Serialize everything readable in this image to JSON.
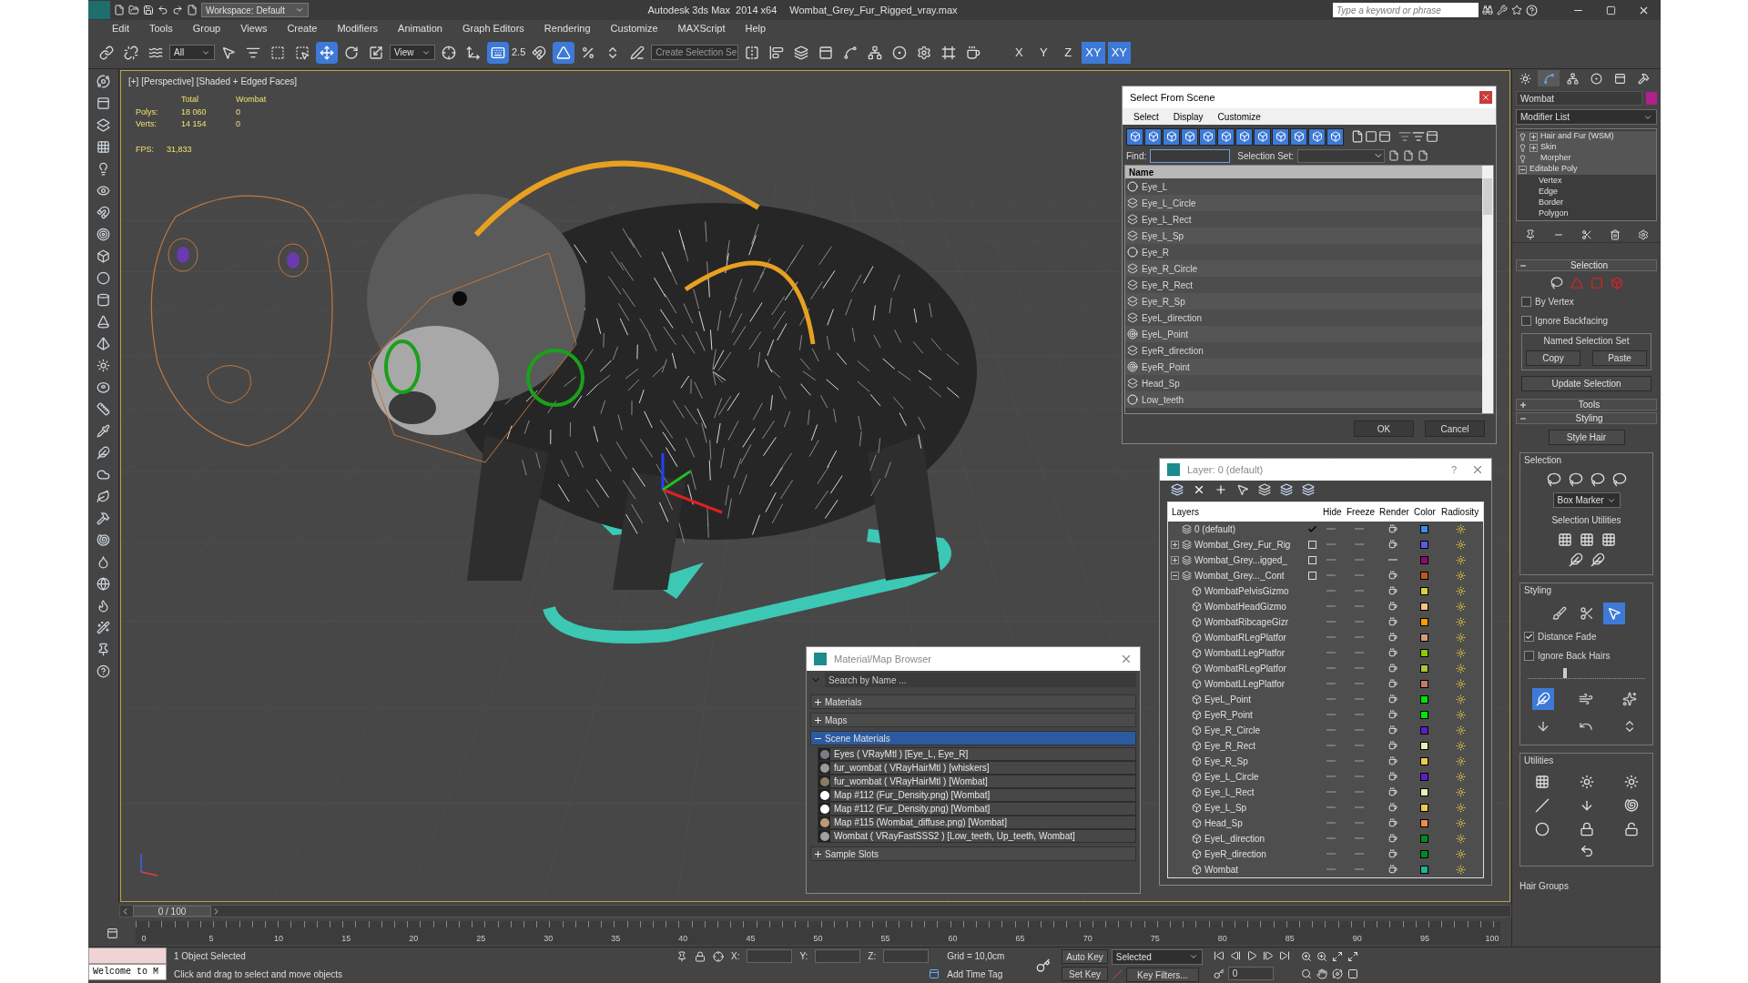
{
  "window": {
    "workspace": "Workspace: Default",
    "title": "Autodesk 3ds Max  2014 x64",
    "file": "Wombat_Grey_Fur_Rigged_vray.max",
    "search_placeholder": "Type a keyword or phrase"
  },
  "menu": [
    "Edit",
    "Tools",
    "Group",
    "Views",
    "Create",
    "Modifiers",
    "Animation",
    "Graph Editors",
    "Rendering",
    "Customize",
    "MAXScript",
    "Help"
  ],
  "toolbar": {
    "filter": "All",
    "reference": "View",
    "snap_label": "2.5",
    "selection_set_placeholder": "Create Selection Se",
    "buttons": [
      {
        "selected": false
      },
      {
        "selected": false
      },
      {
        "selected": false
      },
      {
        "selected": false
      },
      {
        "selected": false
      },
      {
        "selected": false
      },
      {
        "selected": false
      },
      {
        "selected": true
      },
      {
        "selected": false
      },
      {
        "selected": false
      },
      {
        "selected": false
      },
      {
        "selected": false
      },
      {
        "selected": true
      },
      {
        "selected": false
      },
      {
        "selected": true
      },
      {
        "selected": false
      },
      {
        "selected": false
      },
      {
        "selected": false
      },
      {
        "selected": false
      },
      {
        "selected": false
      },
      {
        "selected": false
      },
      {
        "selected": false
      },
      {
        "selected": false
      },
      {
        "selected": false
      },
      {
        "selected": false
      },
      {
        "selected": false
      },
      {
        "selected": false
      },
      {
        "selected": false
      }
    ],
    "axes": [
      {
        "label": "X",
        "selected": false
      },
      {
        "label": "Y",
        "selected": false
      },
      {
        "label": "Z",
        "selected": false
      },
      {
        "label": "XY",
        "selected": true
      },
      {
        "label": "XY",
        "selected": true
      }
    ]
  },
  "viewport": {
    "label": "[+] [Perspective] [Shaded + Edged Faces]",
    "stats_headers": [
      "Total",
      "Wombat"
    ],
    "stats": [
      {
        "label": "Polys:",
        "values": [
          "18 060",
          "0"
        ]
      },
      {
        "label": "Verts:",
        "values": [
          "14 154",
          "0"
        ]
      }
    ],
    "fps_label": "FPS:",
    "fps": "31,833"
  },
  "select_from_scene": {
    "title": "Select From Scene",
    "menu": [
      "Select",
      "Display",
      "Customize"
    ],
    "filters": [
      {
        "selected": true
      },
      {
        "selected": true
      },
      {
        "selected": true
      },
      {
        "selected": true
      },
      {
        "selected": true
      },
      {
        "selected": true
      },
      {
        "selected": true
      },
      {
        "selected": true
      },
      {
        "selected": true
      },
      {
        "selected": true
      },
      {
        "selected": true
      },
      {
        "selected": true
      }
    ],
    "find_label": "Find:",
    "selection_set_label": "Selection Set:",
    "column": "Name",
    "items": [
      {
        "name": "Eye_L",
        "kind": "geometry"
      },
      {
        "name": "Eye_L_Circle",
        "kind": "shape"
      },
      {
        "name": "Eye_L_Rect",
        "kind": "shape"
      },
      {
        "name": "Eye_L_Sp",
        "kind": "shape"
      },
      {
        "name": "Eye_R",
        "kind": "geometry"
      },
      {
        "name": "Eye_R_Circle",
        "kind": "shape"
      },
      {
        "name": "Eye_R_Rect",
        "kind": "shape"
      },
      {
        "name": "Eye_R_Sp",
        "kind": "shape"
      },
      {
        "name": "EyeL_direction",
        "kind": "shape"
      },
      {
        "name": "EyeL_Point",
        "kind": "helper"
      },
      {
        "name": "EyeR_direction",
        "kind": "shape"
      },
      {
        "name": "EyeR_Point",
        "kind": "helper"
      },
      {
        "name": "Head_Sp",
        "kind": "shape"
      },
      {
        "name": "Low_teeth",
        "kind": "geometry"
      }
    ],
    "buttons": [
      "OK",
      "Cancel"
    ]
  },
  "layer_dialog": {
    "title": "Layer: 0 (default)",
    "help": "?",
    "columns": [
      "Layers",
      "Hide",
      "Freeze",
      "Render",
      "Color",
      "Radiosity"
    ],
    "rows": [
      {
        "name": "0 (default)",
        "current": true,
        "render": true,
        "color": "#3d8ee8"
      },
      {
        "name": "Wombat_Grey_Fur_Rig",
        "expanded": false,
        "current": false,
        "render": true,
        "color": "#5b5ae8"
      },
      {
        "name": "Wombat_Grey...igged_",
        "expanded": false,
        "current": false,
        "render": false,
        "color": "#8a0a6e"
      },
      {
        "name": "Wombat_Grey..._Cont",
        "expanded": true,
        "current": false,
        "render": true,
        "color": "#c0581a",
        "children": [
          {
            "name": "WombatPelvisGizmo",
            "render": true,
            "color": "#d2d23c"
          },
          {
            "name": "WombatHeadGizmo",
            "render": true,
            "color": "#f5c08c"
          },
          {
            "name": "WombatRibcageGizr",
            "render": true,
            "color": "#ff9a00"
          },
          {
            "name": "WombatRLegPlatfor",
            "render": true,
            "color": "#d29a78"
          },
          {
            "name": "WombatLLegPlatfor",
            "render": true,
            "color": "#8cc800"
          },
          {
            "name": "WombatRLegPlatfor",
            "render": true,
            "color": "#a8c83c"
          },
          {
            "name": "WombatLLegPlatfor",
            "render": true,
            "color": "#c87864"
          },
          {
            "name": "EyeL_Point",
            "render": true,
            "color": "#00e600"
          },
          {
            "name": "EyeR_Point",
            "render": true,
            "color": "#00e601"
          },
          {
            "name": "Eye_R_Circle",
            "render": true,
            "color": "#5a1ec8"
          },
          {
            "name": "Eye_R_Rect",
            "render": true,
            "color": "#e6f0b4"
          },
          {
            "name": "Eye_R_Sp",
            "render": true,
            "color": "#f0c850"
          },
          {
            "name": "Eye_L_Circle",
            "render": true,
            "color": "#5a1ec9"
          },
          {
            "name": "Eye_L_Rect",
            "render": true,
            "color": "#e6f0b5"
          },
          {
            "name": "Eye_L_Sp",
            "render": true,
            "color": "#f0c851"
          },
          {
            "name": "Head_Sp",
            "render": true,
            "color": "#f08c50"
          },
          {
            "name": "EyeL_direction",
            "render": true,
            "color": "#008c1e"
          },
          {
            "name": "EyeR_direction",
            "render": true,
            "color": "#008c1f"
          },
          {
            "name": "Wombat",
            "render": true,
            "color": "#1eb49a"
          }
        ]
      }
    ]
  },
  "material_browser": {
    "title": "Material/Map Browser",
    "search_placeholder": "Search by Name ...",
    "groups": [
      {
        "label": "Materials",
        "expanded": false
      },
      {
        "label": "Maps",
        "expanded": false
      },
      {
        "label": "Scene Materials",
        "expanded": true,
        "items": [
          {
            "name": "Eyes  ( VRayMtl )  [Eye_L, Eye_R]",
            "color": "#7c7c84"
          },
          {
            "name": "fur_wombat  ( VRayHairMtl )  [whiskers]",
            "color": "#9a9a9a"
          },
          {
            "name": "fur_wombat  ( VRayHairMtl ) [Wombat]",
            "color": "#8a7a66"
          },
          {
            "name": "Map #112 (Fur_Density.png)  [Wombat]",
            "color": "#ffffff"
          },
          {
            "name": "Map #112 (Fur_Density.png)  [Wombat]",
            "color": "#fefefe"
          },
          {
            "name": "Map #115 (Wombat_diffuse.png)  [Wombat]",
            "color": "#b89a78"
          },
          {
            "name": "Wombat  ( VRayFastSSS2 )  [Low_teeth, Up_teeth, Wombat]",
            "color": "#a0a0a0"
          }
        ]
      },
      {
        "label": "Sample Slots",
        "expanded": false
      }
    ]
  },
  "command_panel": {
    "tabs": [
      {
        "selected": false
      },
      {
        "selected": true
      },
      {
        "selected": false
      },
      {
        "selected": false
      },
      {
        "selected": false
      },
      {
        "selected": false
      }
    ],
    "object_name": "Wombat",
    "modifier_list": "Modifier List",
    "stack": [
      {
        "label": "Hair and Fur (WSM)",
        "expanded": false
      },
      {
        "label": "Skin",
        "expanded": false
      },
      {
        "label": "Morpher"
      },
      {
        "label": "Editable Poly",
        "expanded": true,
        "children": [
          {
            "label": "Vertex"
          },
          {
            "label": "Edge"
          },
          {
            "label": "Border"
          },
          {
            "label": "Polygon"
          }
        ]
      }
    ],
    "rollouts": [
      {
        "kind": "selection",
        "title": "Selection",
        "expanded": true,
        "options": [
          {
            "label": "By Vertex",
            "checked": false
          },
          {
            "label": "Ignore Backfacing",
            "checked": false
          }
        ],
        "group": "Named Selection Set",
        "buttons": [
          "Copy",
          "Paste"
        ],
        "action": "Update Selection"
      },
      {
        "kind": "tools",
        "title": "Tools",
        "expanded": false
      },
      {
        "kind": "styling",
        "title": "Styling",
        "expanded": true,
        "action": "Style Hair",
        "selection_group": "Selection",
        "marker": "Box Marker",
        "utilities_label": "Selection Utilities",
        "styling_group": "Styling",
        "tools": [
          {
            "selected": false
          },
          {
            "selected": false
          },
          {
            "selected": true
          }
        ],
        "options": [
          {
            "label": "Distance Fade",
            "checked": true
          },
          {
            "label": "Ignore Back Hairs",
            "checked": false
          }
        ],
        "slider": {
          "level": 0.3
        },
        "brushes": [
          {
            "selected": true
          },
          {
            "selected": false
          },
          {
            "selected": false
          },
          {
            "selected": false
          },
          {
            "selected": false
          },
          {
            "selected": false
          }
        ],
        "utilities_group": "Utilities",
        "hair_groups": "Hair Groups"
      }
    ]
  },
  "timeline": {
    "frame": "0 / 100",
    "ticks": [
      "0",
      "5",
      "10",
      "15",
      "20",
      "25",
      "30",
      "35",
      "40",
      "45",
      "50",
      "55",
      "60",
      "65",
      "70",
      "75",
      "80",
      "85",
      "90",
      "95",
      "100"
    ]
  },
  "status": {
    "maxscript": "Welcome to M",
    "selection": "1 Object Selected",
    "prompt": "Click and drag to select and move objects",
    "x_label": "X:",
    "y_label": "Y:",
    "z_label": "Z:",
    "grid": "Grid = 10,0cm",
    "add_time_tag": "Add Time Tag",
    "auto_key": "Auto Key",
    "set_key": "Set Key",
    "key_mode": "Selected",
    "key_filters": "Key Filters...",
    "frame": "0"
  }
}
